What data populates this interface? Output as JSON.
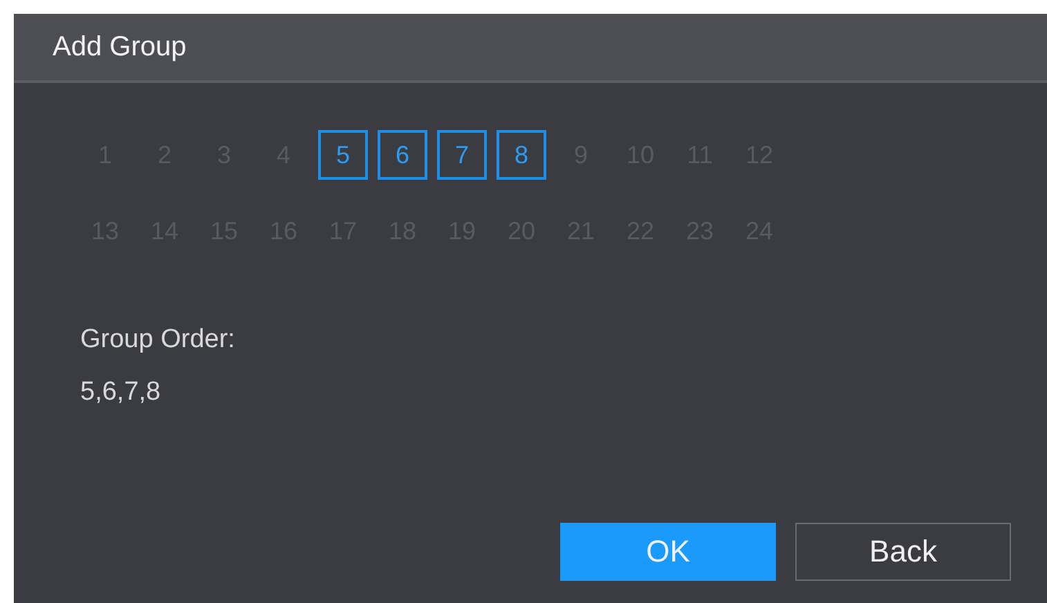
{
  "window": {
    "title": "Add Group"
  },
  "channels": [
    {
      "label": "1",
      "selected": false
    },
    {
      "label": "2",
      "selected": false
    },
    {
      "label": "3",
      "selected": false
    },
    {
      "label": "4",
      "selected": false
    },
    {
      "label": "5",
      "selected": true
    },
    {
      "label": "6",
      "selected": true
    },
    {
      "label": "7",
      "selected": true
    },
    {
      "label": "8",
      "selected": true
    },
    {
      "label": "9",
      "selected": false
    },
    {
      "label": "10",
      "selected": false
    },
    {
      "label": "11",
      "selected": false
    },
    {
      "label": "12",
      "selected": false
    },
    {
      "label": "13",
      "selected": false
    },
    {
      "label": "14",
      "selected": false
    },
    {
      "label": "15",
      "selected": false
    },
    {
      "label": "16",
      "selected": false
    },
    {
      "label": "17",
      "selected": false
    },
    {
      "label": "18",
      "selected": false
    },
    {
      "label": "19",
      "selected": false
    },
    {
      "label": "20",
      "selected": false
    },
    {
      "label": "21",
      "selected": false
    },
    {
      "label": "22",
      "selected": false
    },
    {
      "label": "23",
      "selected": false
    },
    {
      "label": "24",
      "selected": false
    }
  ],
  "group_order": {
    "label": "Group Order:",
    "value": "5,6,7,8"
  },
  "buttons": [
    {
      "label": "OK",
      "kind": "primary"
    },
    {
      "label": "Back",
      "kind": "secondary"
    }
  ]
}
